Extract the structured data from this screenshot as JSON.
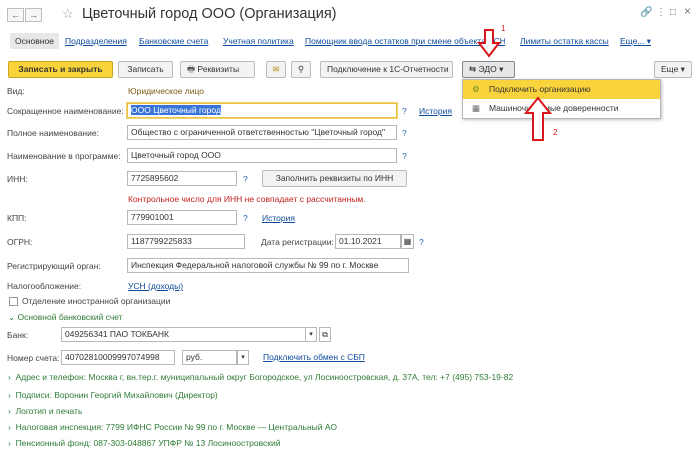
{
  "window": {
    "title": "Цветочный город ООО (Организация)",
    "back": "←",
    "forward": "→",
    "more": "⋮",
    "link": "🔗",
    "maximize": "□",
    "close": "×"
  },
  "tabs": [
    "Основное",
    "Подразделения",
    "Банковские счета",
    "Учетная политика",
    "Помощник ввода остатков при смене объекта УСН",
    "Лимиты остатка кассы",
    "Еще..."
  ],
  "toolbar": {
    "save_close": "Записать и закрыть",
    "save": "Записать",
    "requisites": "Реквизиты",
    "connect_1c": "Подключение к 1С-Отчетности",
    "edo": "ЭДО",
    "more": "Еще"
  },
  "edo_menu": [
    "Подключить организацию",
    "Машиночитаемые доверенности"
  ],
  "annotations": {
    "n1": "1",
    "n2": "2"
  },
  "form": {
    "vid": {
      "label": "Вид:",
      "value": "Юридическое лицо"
    },
    "short_name": {
      "label": "Сокращенное наименование:",
      "value": "ООО Цветочный город",
      "history": "История"
    },
    "full_name": {
      "label": "Полное наименование:",
      "value": "Общество с ограниченной ответственностью \"Цветочный город\""
    },
    "program_name": {
      "label": "Наименование в программе:",
      "value": "Цветочный город ООО"
    },
    "inn": {
      "label": "ИНН:",
      "value": "7725895602",
      "fill_button": "Заполнить реквизиты по ИНН",
      "error": "Контрольное число для ИНН не совпадает с рассчитанным."
    },
    "kpp": {
      "label": "КПП:",
      "value": "779901001",
      "history": "История"
    },
    "ogrn": {
      "label": "ОГРН:",
      "value": "1187799225833",
      "reg_label": "Дата регистрации:",
      "reg_date": "01.10.2021"
    },
    "reg_org": {
      "label": "Регистрирующий орган:",
      "value": "Инспекция Федеральной налоговой службы № 99 по г. Москве"
    },
    "tax": {
      "label": "Налогообложение:",
      "value": "УСН (доходы)"
    },
    "foreign": {
      "label": "Отделение иностранной организации"
    },
    "bank_section": {
      "title": "Основной банковский счет",
      "bank_label": "Банк:",
      "bank_value": "049256341 ПАО ТОКБАНК",
      "account_label": "Номер счета:",
      "account_value": "40702810009997074998",
      "currency": "руб.",
      "sbp": "Подключить обмен с СБП"
    },
    "sections": [
      "Адрес и телефон: Москва г, вн.тер.г. муниципальный округ Богородское, ул Лосиноостровская, д. 37А, тел: +7 (495) 753-19-82",
      "Подписи: Воронин Георгий Михайлович (Директор)",
      "Логотип и печать",
      "Налоговая инспекция: 7799 ИФНС России № 99 по г. Москве — Центральный АО",
      "Пенсионный фонд: 087-303-048867 УПФР № 13 Лосиноостровский"
    ]
  }
}
